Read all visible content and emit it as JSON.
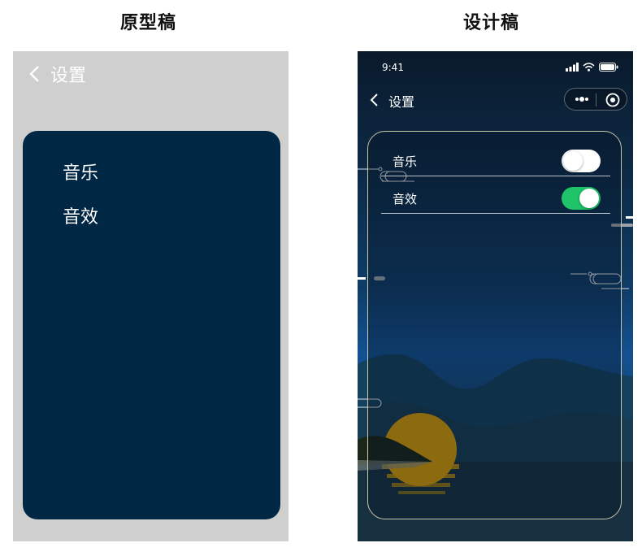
{
  "captions": {
    "prototype": "原型稿",
    "design": "设计稿"
  },
  "prototype": {
    "header_title": "设置",
    "items": [
      {
        "label": "音乐"
      },
      {
        "label": "音效"
      }
    ],
    "colors": {
      "background": "#cfcfcf",
      "panel": "#002744"
    }
  },
  "design": {
    "status_bar": {
      "time": "9:41"
    },
    "nav": {
      "title": "设置",
      "back_icon": "chevron-left-icon"
    },
    "capsule": {
      "more_icon": "more-dots-icon",
      "close_icon": "target-icon"
    },
    "settings": [
      {
        "label": "音乐",
        "enabled": false
      },
      {
        "label": "音效",
        "enabled": true
      }
    ],
    "colors": {
      "toggle_on": "#1ec467",
      "toggle_off": "#ffffff",
      "panel_border": "#c9c6a9",
      "moon": "#d49a06"
    }
  }
}
